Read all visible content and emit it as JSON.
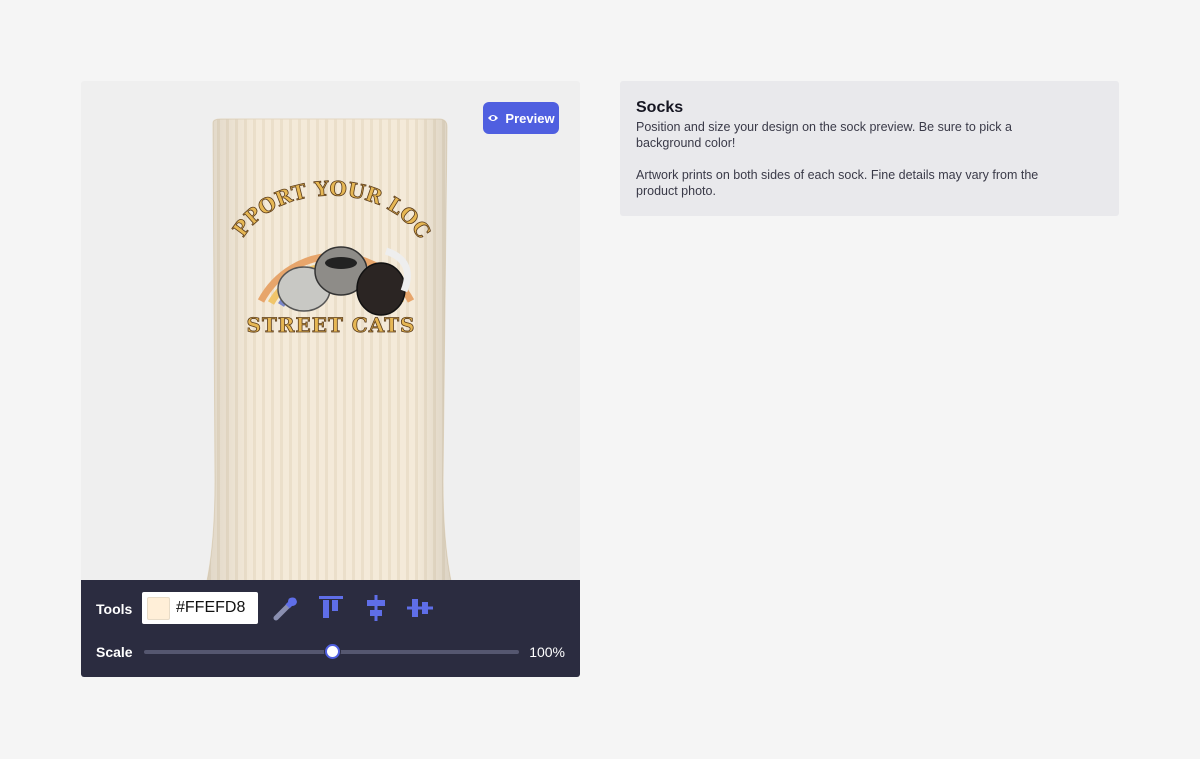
{
  "editor": {
    "preview_label": "Preview",
    "artwork": {
      "top_text": "SUPPORT YOUR LOCAL",
      "bottom_text": "STREET CATS"
    },
    "tools": {
      "label": "Tools",
      "background_color": "#FFEFD8",
      "icons": [
        "eyedropper-icon",
        "align-top-icon",
        "align-center-vertical-icon",
        "align-center-horizontal-icon"
      ]
    },
    "scale": {
      "label": "Scale",
      "value_text": "100%",
      "slider_fraction": 0.5
    }
  },
  "info": {
    "title": "Socks",
    "paragraph1": "Position and size your design on the sock preview. Be sure to pick a background color!",
    "paragraph2": "Artwork prints on both sides of each sock. Fine details may vary from the product photo."
  },
  "colors": {
    "accent": "#4f5fe0",
    "toolbar_bg": "#2b2c40",
    "sock": "#FFEFD8"
  }
}
